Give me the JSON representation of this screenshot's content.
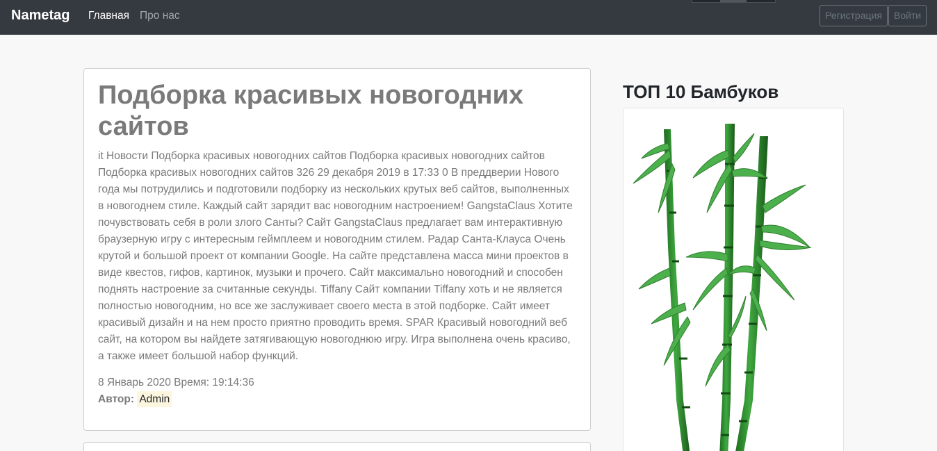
{
  "navbar": {
    "brand": "Nametag",
    "links": {
      "home": "Главная",
      "about": "Про нас"
    },
    "buttons": {
      "register": "Регистрация",
      "login": "Войти"
    }
  },
  "post": {
    "title": "Подборка красивых новогодних сайтов",
    "body": "it Новости Подборка красивых новогодних сайтов Подборка красивых новогодних сайтов Подборка красивых новогодних сайтов 326 29 декабря 2019 в 17:33 0 В преддверии Нового года мы потрудились и подготовили подборку из нескольких крутых веб сайтов, выполненных в новогоднем стиле. Каждый сайт зарядит вас новогодним настроением! GangstaClaus Хотите почувствовать себя в роли злого Санты? Сайт GangstaClaus предлагает вам интерактивную браузерную игру с интересным геймплеем и новогодним стилем. Радар Санта-Клауса Очень крутой и большой проект от компании Google. На сайте представлена масса мини проектов в виде квестов, гифов, картинок, музыки и прочего. Сайт максимально новогодний и способен поднять настроение за считанные секунды. Tiffany Сайт компании Tiffany хоть и не является полностью новогодним, но все же заслуживает своего места в этой подборке. Сайт имеет красивый дизайн и на нем просто приятно проводить время. SPAR Красивый новогодний веб сайт, на котором вы найдете затягивающую новогоднюю игру. Игра выполнена очень красиво, а также имеет большой набор функций.",
    "date_time": "8 Январь 2020 Время: 19:14:36",
    "author_label": "Автор:",
    "author_name": "Admin"
  },
  "sidebar": {
    "title": "ТОП 10 Бамбуков",
    "image_icon": "bamboo-illustration"
  },
  "colors": {
    "navbar_bg": "#343a40",
    "page_bg": "#f8f8f8",
    "post_text": "#7a7a7a",
    "author_highlight": "#fdf6df",
    "bamboo_green": "#2e8b2e"
  }
}
